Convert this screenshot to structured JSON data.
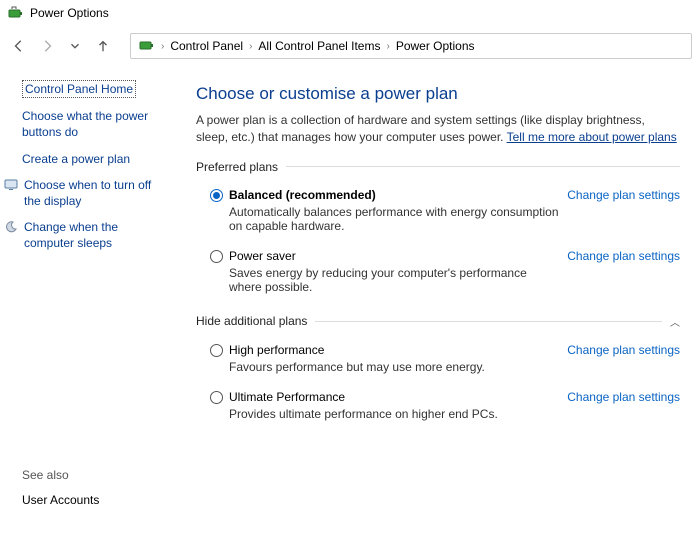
{
  "window": {
    "title": "Power Options"
  },
  "breadcrumb": {
    "items": [
      "Control Panel",
      "All Control Panel Items",
      "Power Options"
    ]
  },
  "sidebar": {
    "home": "Control Panel Home",
    "links": {
      "buttons": "Choose what the power buttons do",
      "create": "Create a power plan",
      "turnoff": "Choose when to turn off the display",
      "sleeps": "Change when the computer sleeps"
    },
    "see_also": {
      "header": "See also",
      "user_accounts": "User Accounts"
    }
  },
  "main": {
    "heading": "Choose or customise a power plan",
    "desc_a": "A power plan is a collection of hardware and system settings (like display brightness, sleep, etc.) that manages how your computer uses power. ",
    "desc_link": "Tell me more about power plans",
    "preferred_hdr": "Preferred plans",
    "hide_hdr": "Hide additional plans",
    "change_label": "Change plan settings",
    "plans": {
      "balanced": {
        "title": "Balanced (recommended)",
        "sub": "Automatically balances performance with energy consumption on capable hardware."
      },
      "saver": {
        "title": "Power saver",
        "sub": "Saves energy by reducing your computer's performance where possible."
      },
      "high": {
        "title": "High performance",
        "sub": "Favours performance but may use more energy."
      },
      "ultimate": {
        "title": "Ultimate Performance",
        "sub": "Provides ultimate performance on higher end PCs."
      }
    }
  }
}
